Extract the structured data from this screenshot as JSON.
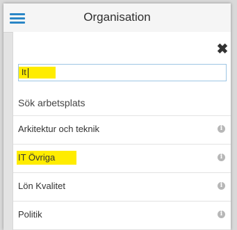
{
  "header": {
    "title": "Organisation",
    "menu_icon": "hamburger-menu-icon"
  },
  "panel": {
    "close_icon": "close-icon",
    "search": {
      "value": "It",
      "highlight_color": "#ffec00"
    },
    "section_title": "Sök arbetsplats",
    "items": [
      {
        "label": "Arkitektur och teknik",
        "info_icon": "info-icon",
        "highlighted": false
      },
      {
        "label": "IT Övriga",
        "info_icon": "info-icon",
        "highlighted": true
      },
      {
        "label": "Lön Kvalitet",
        "info_icon": "info-icon",
        "highlighted": false
      },
      {
        "label": "Politik",
        "info_icon": "info-icon",
        "highlighted": false
      }
    ]
  },
  "colors": {
    "accent": "#2a86c6",
    "highlight": "#ffec00"
  }
}
